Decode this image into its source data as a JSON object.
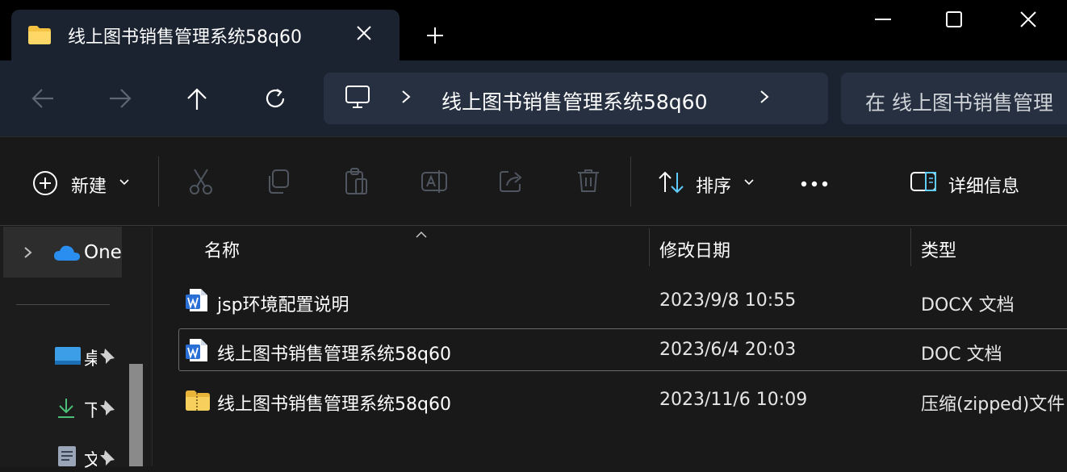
{
  "tab": {
    "title": "线上图书销售管理系统58q60"
  },
  "window_controls": {
    "minimize": "minimize-icon",
    "maximize": "maximize-icon",
    "close": "close-icon"
  },
  "address": {
    "path": "线上图书销售管理系统58q60",
    "search_placeholder": "在 线上图书销售管理"
  },
  "toolbar": {
    "new_label": "新建",
    "sort_label": "排序",
    "details_label": "详细信息"
  },
  "sidebar": {
    "onedrive_label": "One",
    "pinned": [
      {
        "label": "桌",
        "icon": "desktop-icon"
      },
      {
        "label": "下",
        "icon": "download-icon"
      },
      {
        "label": "文",
        "icon": "documents-icon"
      }
    ]
  },
  "columns": {
    "name": "名称",
    "modified": "修改日期",
    "type": "类型"
  },
  "files": [
    {
      "name": "jsp环境配置说明",
      "modified": "2023/9/8 10:55",
      "type": "DOCX 文档",
      "icon": "word-doc-icon"
    },
    {
      "name": "线上图书销售管理系统58q60",
      "modified": "2023/6/4 20:03",
      "type": "DOC 文档",
      "icon": "word-doc-icon",
      "selected": true
    },
    {
      "name": "线上图书销售管理系统58q60",
      "modified": "2023/11/6 10:09",
      "type": "压缩(zipped)文件",
      "icon": "zip-folder-icon"
    }
  ],
  "colors": {
    "accent": "#60cdff",
    "word_blue": "#2a6fd6",
    "folder_yellow": "#f5c242"
  }
}
